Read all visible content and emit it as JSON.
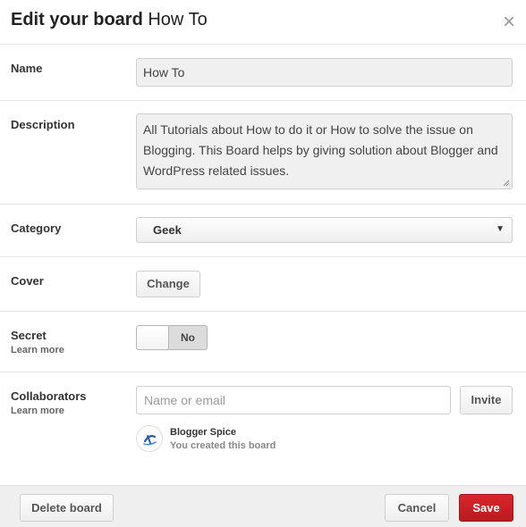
{
  "header": {
    "title_prefix": "Edit your board",
    "board_name": "How To",
    "close_glyph": "×"
  },
  "name": {
    "label": "Name",
    "value": "How To"
  },
  "description": {
    "label": "Description",
    "lines": [
      "All Tutorials about How to do it or How to solve the issue on",
      "Blogging. This Board helps by giving solution about Blogger and",
      "WordPress related issues."
    ]
  },
  "category": {
    "label": "Category",
    "selected": "Geek",
    "arrow": "▼"
  },
  "cover": {
    "label": "Cover",
    "button": "Change"
  },
  "secret": {
    "label": "Secret",
    "learn_more": "Learn more",
    "state": "No"
  },
  "collaborators": {
    "label": "Collaborators",
    "learn_more": "Learn more",
    "placeholder": "Name or email",
    "invite_button": "Invite",
    "owner": {
      "name": "Blogger Spice",
      "note": "You created this board"
    }
  },
  "footer": {
    "delete_button": "Delete board",
    "cancel_button": "Cancel",
    "save_button": "Save"
  },
  "colors": {
    "save_red": "#c8202a",
    "divider": "#e5e5e5",
    "footer_bg": "#efefef",
    "avatar_blue": "#2b5a9e"
  }
}
